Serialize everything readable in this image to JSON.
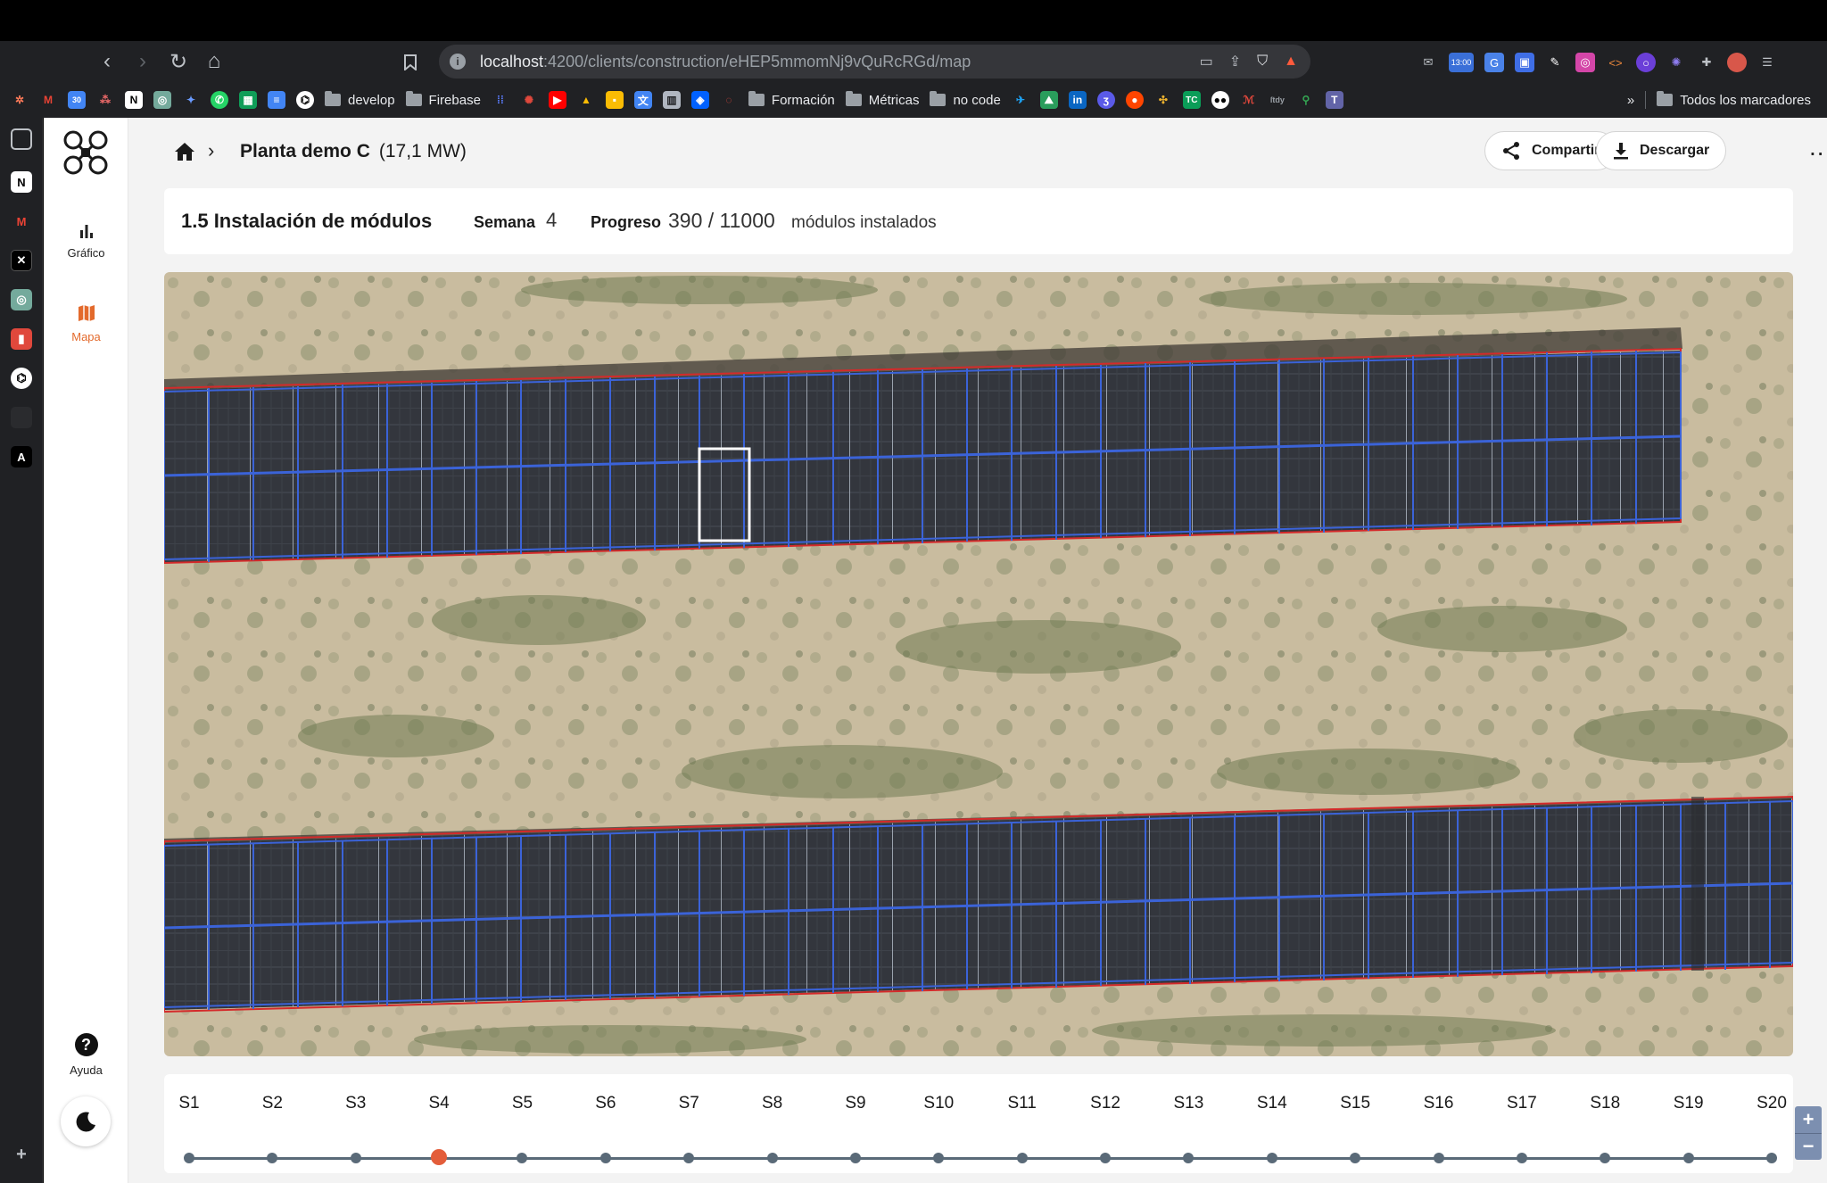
{
  "browser": {
    "url_host": "localhost",
    "url_rest": ":4200/clients/construction/eHEP5mmomNj9vQuRcRGd/map",
    "ext_badge": "13:00",
    "bookmarks": [
      {
        "type": "folder",
        "label": "develop"
      },
      {
        "type": "folder",
        "label": "Firebase"
      },
      {
        "type": "folder",
        "label": "Formación"
      },
      {
        "type": "folder",
        "label": "Métricas"
      },
      {
        "type": "folder",
        "label": "no code"
      }
    ],
    "all_bookmarks_label": "Todos los marcadores",
    "overflow_label": "»"
  },
  "app": {
    "nav": {
      "chart_label": "Gráfico",
      "map_label": "Mapa",
      "help_label": "Ayuda"
    },
    "breadcrumb": {
      "title": "Planta demo C",
      "power": "(17,1 MW)"
    },
    "actions": {
      "share_label": "Compartir",
      "download_label": "Descargar",
      "more_label": "..."
    },
    "task": {
      "title": "1.5 Instalación de módulos",
      "week_label": "Semana",
      "week_value": "4",
      "progress_label": "Progreso",
      "progress_value": "390 / 11000",
      "progress_unit": "módulos instalados",
      "installed": 390,
      "total": 11000
    },
    "map": {
      "zoom_in": "+",
      "zoom_out": "−",
      "colors": {
        "installed_outline": "#3b63d8",
        "planned_outline": "#d42a2a",
        "selected_outline": "#ffffff"
      }
    },
    "timeline": {
      "weeks": [
        "S1",
        "S2",
        "S3",
        "S4",
        "S5",
        "S6",
        "S7",
        "S8",
        "S9",
        "S10",
        "S11",
        "S12",
        "S13",
        "S14",
        "S15",
        "S16",
        "S17",
        "S18",
        "S19",
        "S20"
      ],
      "current_index": 3,
      "accent": "#e35d3a"
    }
  }
}
